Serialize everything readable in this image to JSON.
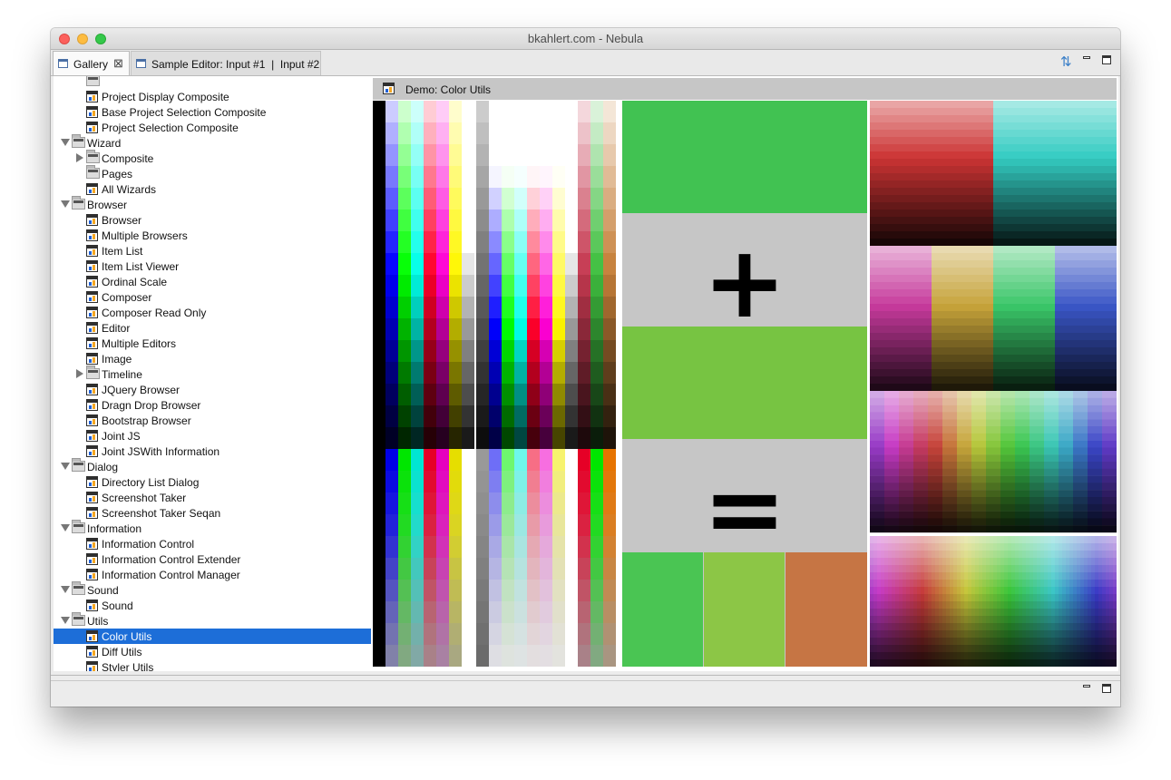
{
  "window": {
    "title": "bkahlert.com - Nebula"
  },
  "tabs": [
    {
      "label": "Gallery",
      "active": true,
      "closable": true
    },
    {
      "label": "Sample Editor: Input #1  |  Input #2",
      "active": false
    }
  ],
  "tree": [
    {
      "label": "",
      "level": 1,
      "kind": "partial"
    },
    {
      "label": "Project Display Composite",
      "level": 1,
      "kind": "demo"
    },
    {
      "label": "Base Project Selection Composite",
      "level": 1,
      "kind": "demo"
    },
    {
      "label": "Project Selection Composite",
      "level": 1,
      "kind": "demo"
    },
    {
      "label": "Wizard",
      "level": 0,
      "kind": "category",
      "twisty": "open"
    },
    {
      "label": "Composite",
      "level": 1,
      "kind": "category",
      "twisty": "closed"
    },
    {
      "label": "Pages",
      "level": 1,
      "kind": "category"
    },
    {
      "label": "All Wizards",
      "level": 1,
      "kind": "demo"
    },
    {
      "label": "Browser",
      "level": 0,
      "kind": "category",
      "twisty": "open"
    },
    {
      "label": "Browser",
      "level": 1,
      "kind": "demo"
    },
    {
      "label": "Multiple Browsers",
      "level": 1,
      "kind": "demo"
    },
    {
      "label": "Item List",
      "level": 1,
      "kind": "demo"
    },
    {
      "label": "Item List Viewer",
      "level": 1,
      "kind": "demo"
    },
    {
      "label": "Ordinal Scale",
      "level": 1,
      "kind": "demo"
    },
    {
      "label": "Composer",
      "level": 1,
      "kind": "demo"
    },
    {
      "label": "Composer Read Only",
      "level": 1,
      "kind": "demo"
    },
    {
      "label": "Editor",
      "level": 1,
      "kind": "demo"
    },
    {
      "label": "Multiple Editors",
      "level": 1,
      "kind": "demo"
    },
    {
      "label": "Image",
      "level": 1,
      "kind": "demo"
    },
    {
      "label": "Timeline",
      "level": 1,
      "kind": "category",
      "twisty": "closed"
    },
    {
      "label": "JQuery Browser",
      "level": 1,
      "kind": "demo"
    },
    {
      "label": "Dragn Drop Browser",
      "level": 1,
      "kind": "demo"
    },
    {
      "label": "Bootstrap Browser",
      "level": 1,
      "kind": "demo"
    },
    {
      "label": "Joint JS",
      "level": 1,
      "kind": "demo"
    },
    {
      "label": "Joint JSWith Information",
      "level": 1,
      "kind": "demo"
    },
    {
      "label": "Dialog",
      "level": 0,
      "kind": "category",
      "twisty": "open"
    },
    {
      "label": "Directory List Dialog",
      "level": 1,
      "kind": "demo"
    },
    {
      "label": "Screenshot Taker",
      "level": 1,
      "kind": "demo"
    },
    {
      "label": "Screenshot Taker Seqan",
      "level": 1,
      "kind": "demo"
    },
    {
      "label": "Information",
      "level": 0,
      "kind": "category",
      "twisty": "open"
    },
    {
      "label": "Information Control",
      "level": 1,
      "kind": "demo"
    },
    {
      "label": "Information Control Extender",
      "level": 1,
      "kind": "demo"
    },
    {
      "label": "Information Control Manager",
      "level": 1,
      "kind": "demo"
    },
    {
      "label": "Sound",
      "level": 0,
      "kind": "category",
      "twisty": "open"
    },
    {
      "label": "Sound",
      "level": 1,
      "kind": "demo"
    },
    {
      "label": "Utils",
      "level": 0,
      "kind": "category",
      "twisty": "open"
    },
    {
      "label": "Color Utils",
      "level": 1,
      "kind": "demo",
      "selected": true
    },
    {
      "label": "Diff Utils",
      "level": 1,
      "kind": "demo"
    },
    {
      "label": "Styler Utils",
      "level": 1,
      "kind": "demo"
    }
  ],
  "editor": {
    "title": "Demo: Color Utils",
    "addend_a": "#41c252",
    "addend_b": "#77c442",
    "plus_symbol": "+",
    "equals_symbol": "=",
    "results": [
      "#4ac553",
      "#8cc646",
      "#c67544"
    ]
  },
  "colors": {
    "selection": "#1d6ed8",
    "editor_header": "#c6c6c6"
  }
}
